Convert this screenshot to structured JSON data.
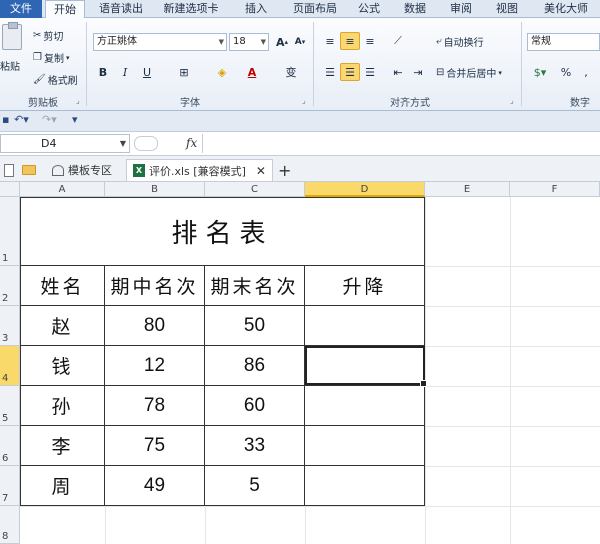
{
  "ribbon_tabs": [
    "文件",
    "开始",
    "语音读出",
    "新建选项卡",
    "插入",
    "页面布局",
    "公式",
    "数据",
    "审阅",
    "视图",
    "美化大师"
  ],
  "clipboard": {
    "paste": "粘贴",
    "cut": "剪切",
    "copy": "复制",
    "format_painter": "格式刷",
    "group": "剪贴板"
  },
  "font": {
    "name": "方正姚体",
    "size": "18",
    "group": "字体",
    "bold": "B",
    "italic": "I",
    "underline": "U",
    "grow": "A",
    "shrink": "A",
    "font_color": "A",
    "phonetic": "变"
  },
  "alignment": {
    "wrap": "自动换行",
    "merge": "合并后居中",
    "group": "对齐方式"
  },
  "number": {
    "format": "常规",
    "percent": "%",
    "comma": ",",
    "group": "数字"
  },
  "formula_bar": {
    "name_box": "D4",
    "fx": "fx",
    "value": ""
  },
  "doc_tabs": {
    "template": "模板专区",
    "file": "评价.xls [兼容模式]",
    "close": "✕",
    "add": "+"
  },
  "columns": [
    "A",
    "B",
    "C",
    "D",
    "E",
    "F"
  ],
  "rows": [
    "1",
    "2",
    "3",
    "4",
    "5",
    "6",
    "7",
    "8"
  ],
  "selected": {
    "column": "D",
    "row": "4"
  },
  "table": {
    "title": "排名表",
    "headers": [
      "姓名",
      "期中名次",
      "期末名次",
      "升降"
    ],
    "rows": [
      {
        "name": "赵",
        "mid": "80",
        "final": "50",
        "change": ""
      },
      {
        "name": "钱",
        "mid": "12",
        "final": "86",
        "change": ""
      },
      {
        "name": "孙",
        "mid": "78",
        "final": "60",
        "change": ""
      },
      {
        "name": "李",
        "mid": "75",
        "final": "33",
        "change": ""
      },
      {
        "name": "周",
        "mid": "49",
        "final": "5",
        "change": ""
      }
    ]
  }
}
